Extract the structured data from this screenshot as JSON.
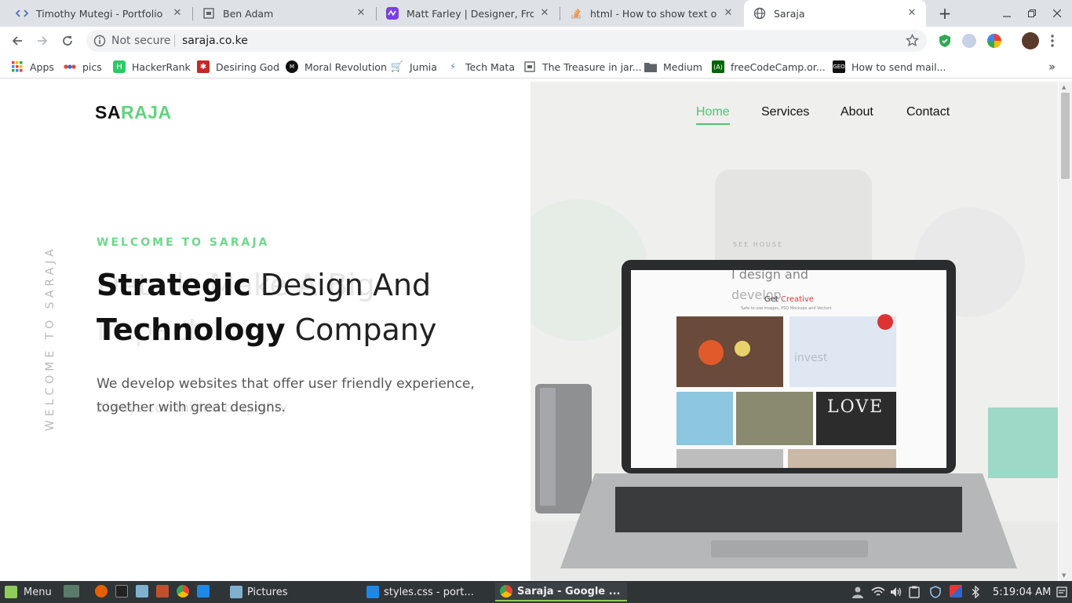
{
  "browser": {
    "tabs": [
      {
        "title": "Timothy Mutegi - Portfolio",
        "icon": "code-icon"
      },
      {
        "title": "Ben Adam",
        "icon": "page-icon"
      },
      {
        "title": "Matt Farley | Designer, Front-e",
        "icon": "pulse-icon"
      },
      {
        "title": "html - How to show text on ima",
        "icon": "stackoverflow-icon"
      },
      {
        "title": "Saraja",
        "icon": "globe-icon"
      }
    ],
    "new_tab_label": "+",
    "address": {
      "security": "Not secure",
      "url": "saraja.co.ke"
    },
    "bookmarks": [
      {
        "label": "Apps",
        "color": "#ea4335"
      },
      {
        "label": "pics",
        "color": "#1a73e8"
      },
      {
        "label": "HackerRank",
        "color": "#2ec866"
      },
      {
        "label": "Desiring God",
        "color": "#c62828"
      },
      {
        "label": "Moral Revolution",
        "color": "#111111"
      },
      {
        "label": "Jumia",
        "color": "#f68b1e"
      },
      {
        "label": "Tech Mata",
        "color": "#4a90d9"
      },
      {
        "label": "The Treasure in jar...",
        "color": "#5f6368"
      },
      {
        "label": "Medium",
        "color": "#5f6368"
      },
      {
        "label": "freeCodeCamp.or...",
        "color": "#006400"
      },
      {
        "label": "How to send mail...",
        "color": "#111111"
      }
    ],
    "overflow_label": "»"
  },
  "site": {
    "logo_dark": "SA",
    "logo_green": "RAJA",
    "nav": [
      "Home",
      "Services",
      "About",
      "Contact"
    ],
    "side_text": "WELCOME TO SARAJA",
    "kicker": "WELCOME TO SARAJA",
    "ghost_line1": "Details Make A Big",
    "ghost_line2": "Impact",
    "ghost_lead": "Always committed to quality",
    "heading_line1_bold": "Strategic",
    "heading_line1_rest": " Design And",
    "heading_line2_bold": "Technology",
    "heading_line2_rest": " Company",
    "lead_line1": "We develop websites that offer user friendly experience,",
    "lead_line2": "together with great designs.",
    "screen_heading_a": "Get ",
    "screen_heading_b": "Creative",
    "screen_caption": "Safe to use images, PSD Mockups and Vectors",
    "screen_love": "LOVE",
    "phone_tag": "SEE HOUSE",
    "phone_line1": "I design and",
    "phone_line2": "develop",
    "phone_line3": "invest",
    "colors": {
      "accent": "#49c86b",
      "logo_green": "#5fd47e"
    }
  },
  "taskbar": {
    "menu_label": "Menu",
    "tasks": [
      {
        "label": "Pictures",
        "icon": "folder-icon"
      },
      {
        "label": "styles.css - port...",
        "icon": "vscode-icon"
      },
      {
        "label": "Saraja - Google ...",
        "icon": "chrome-icon"
      }
    ],
    "clock": "5:19:04 AM"
  }
}
